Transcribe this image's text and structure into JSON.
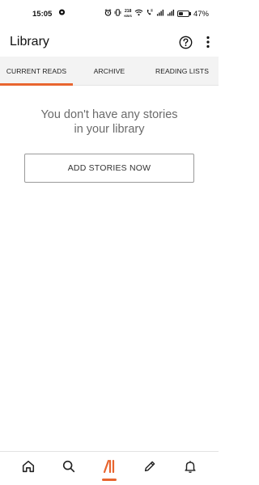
{
  "status_bar": {
    "time": "15:05",
    "network_speed_value": "218",
    "network_speed_unit": "KB/S",
    "battery": "47%"
  },
  "header": {
    "title": "Library",
    "help_icon": "help-circle-icon",
    "more_icon": "more-vertical-icon"
  },
  "tabs": [
    {
      "label": "CURRENT READS",
      "active": true
    },
    {
      "label": "ARCHIVE",
      "active": false
    },
    {
      "label": "READING LISTS",
      "active": false
    }
  ],
  "empty_state": {
    "message_line1": "You don't have any stories",
    "message_line2": "in your library",
    "button_label": "ADD STORIES NOW"
  },
  "bottom_nav": [
    {
      "icon": "home-icon",
      "active": false
    },
    {
      "icon": "search-icon",
      "active": false
    },
    {
      "icon": "library-icon",
      "active": true
    },
    {
      "icon": "pencil-icon",
      "active": false
    },
    {
      "icon": "bell-icon",
      "active": false
    }
  ],
  "colors": {
    "accent": "#e8652f",
    "tab_bar": "#f3f3f3",
    "empty_text": "#6b6b6b"
  }
}
